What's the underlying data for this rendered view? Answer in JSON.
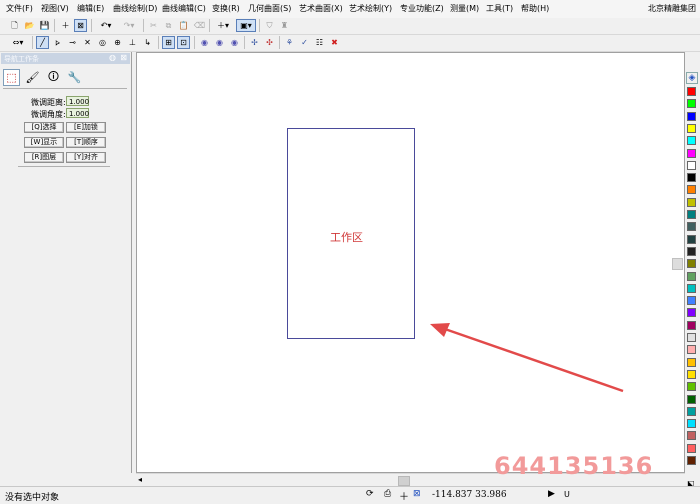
{
  "menu": {
    "items": [
      "文件(F)",
      "视图(V)",
      "编辑(E)",
      "曲线绘制(D)",
      "曲线编辑(C)",
      "变换(R)",
      "几何曲面(S)",
      "艺术曲面(X)",
      "艺术绘制(Y)",
      "专业功能(Z)",
      "测量(M)",
      "工具(T)",
      "帮助(H)"
    ],
    "company": "北京精雕集团"
  },
  "panel": {
    "title": "导航工作条",
    "fine_distance_label": "微调距离:",
    "fine_distance_value": "1.000",
    "fine_angle_label": "微调角度:",
    "fine_angle_value": "1.000",
    "buttons": [
      "[Q]选择",
      "[E]加锁",
      "[W]显示",
      "[T]顺序",
      "[R]图层",
      "[Y]对齐"
    ]
  },
  "canvas": {
    "work_area_label": "工作区"
  },
  "palette": {
    "colors": [
      "#ff0000",
      "#00ff00",
      "#0000ff",
      "#ffff00",
      "#00ffff",
      "#ff00ff",
      "#ffffff",
      "#000000",
      "#ff8000",
      "#c0c000",
      "#008080",
      "#406060",
      "#204040",
      "#202020",
      "#808000",
      "#60a060",
      "#00c0c0",
      "#4080ff",
      "#8000ff",
      "#a00060",
      "#e0e0e0",
      "#ffb0b0",
      "#ffc000",
      "#ffe000",
      "#60c000",
      "#006000",
      "#00a0a0",
      "#00e0ff",
      "#c06060",
      "#ff6060",
      "#602000"
    ]
  },
  "status": {
    "message": "没有选中对象",
    "coordinates": "-114.837 33.986",
    "mode": "U"
  },
  "watermark": "644135136",
  "colors": {
    "accent": "#5a7fb8",
    "work_rect": "#4a4a9a",
    "work_label": "#d03838",
    "arrow": "#e24a4a"
  }
}
